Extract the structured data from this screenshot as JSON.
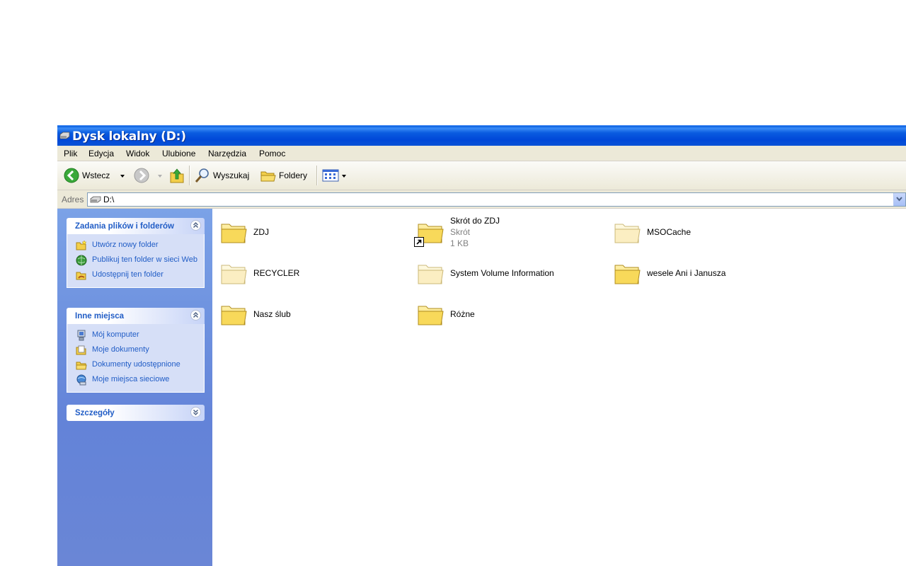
{
  "window": {
    "title": "Dysk lokalny (D:)"
  },
  "menu": [
    "Plik",
    "Edycja",
    "Widok",
    "Ulubione",
    "Narzędzia",
    "Pomoc"
  ],
  "toolbar": {
    "back": "Wstecz",
    "search": "Wyszukaj",
    "folders": "Foldery"
  },
  "address": {
    "label": "Adres",
    "value": "D:\\"
  },
  "tasks": {
    "title": "Zadania plików i folderów",
    "items": [
      "Utwórz nowy folder",
      "Publikuj ten folder w sieci Web",
      "Udostępnij ten folder"
    ]
  },
  "places": {
    "title": "Inne miejsca",
    "items": [
      "Mój komputer",
      "Moje dokumenty",
      "Dokumenty udostępnione",
      "Moje miejsca sieciowe"
    ]
  },
  "details": {
    "title": "Szczegóły"
  },
  "files": [
    {
      "name": "ZDJ"
    },
    {
      "name": "Skrót do ZDJ",
      "type": "Skrót",
      "size": "1 KB"
    },
    {
      "name": "MSOCache"
    },
    {
      "name": "RECYCLER"
    },
    {
      "name": "System Volume Information"
    },
    {
      "name": "wesele Ani i Janusza"
    },
    {
      "name": "Nasz ślub"
    },
    {
      "name": "Różne"
    }
  ],
  "colors": {
    "titlebar": "#0a5ce0",
    "link": "#215dc6",
    "pane": "#7ba2e7",
    "folder": "#f7d34f"
  }
}
